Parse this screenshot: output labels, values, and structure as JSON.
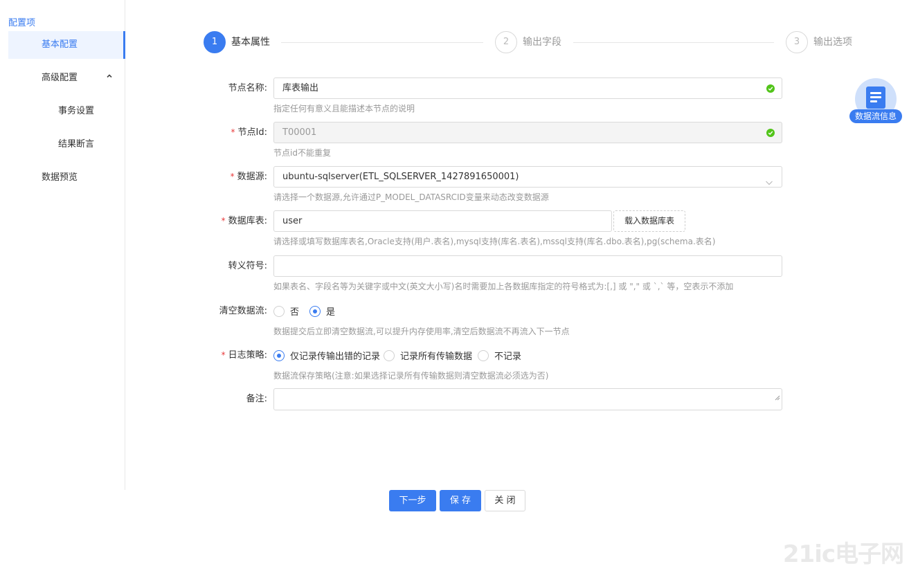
{
  "sidebar": {
    "title": "配置项",
    "items": [
      {
        "label": "基本配置"
      },
      {
        "label": "高级配置"
      },
      {
        "label": "事务设置"
      },
      {
        "label": "结果断言"
      },
      {
        "label": "数据预览"
      }
    ]
  },
  "steps": [
    {
      "num": "1",
      "label": "基本属性",
      "active": true
    },
    {
      "num": "2",
      "label": "输出字段",
      "active": false
    },
    {
      "num": "3",
      "label": "输出选项",
      "active": false
    }
  ],
  "form": {
    "node_name": {
      "label": "节点名称:",
      "value": "库表输出",
      "hint": "指定任何有意义且能描述本节点的说明"
    },
    "node_id": {
      "label": "节点Id:",
      "value": "T00001",
      "hint": "节点id不能重复"
    },
    "datasource": {
      "label": "数据源:",
      "value": "ubuntu-sqlserver(ETL_SQLSERVER_1427891650001)",
      "hint": "请选择一个数据源,允许通过P_MODEL_DATASRCID变量来动态改变数据源"
    },
    "db_table": {
      "label": "数据库表:",
      "value": "user",
      "button": "载入数据库表",
      "hint": "请选择或填写数据库表名,Oracle支持(用户.表名),mysql支持(库名.表名),mssql支持(库名.dbo.表名),pg(schema.表名)"
    },
    "escape": {
      "label": "转义符号:",
      "value": "",
      "hint": "如果表名、字段名等为关键字或中文(英文大小写)名时需要加上各数据库指定的符号格式为:[,] 或 \",\" 或 `,` 等，空表示不添加"
    },
    "clear_flow": {
      "label": "清空数据流:",
      "options": [
        "否",
        "是"
      ],
      "selected": "是",
      "hint": "数据提交后立即清空数据流,可以提升内存使用率,清空后数据流不再流入下一节点"
    },
    "log_policy": {
      "label": "日志策略:",
      "options": [
        "仅记录传输出错的记录",
        "记录所有传输数据",
        "不记录"
      ],
      "selected": "仅记录传输出错的记录",
      "hint": "数据流保存策略(注意:如果选择记录所有传输数据则清空数据流必须选为否)"
    },
    "remark": {
      "label": "备注:",
      "value": ""
    }
  },
  "dataflow_info": {
    "label": "数据流信息",
    "icon": "document-list-icon"
  },
  "footer": {
    "next": "下一步",
    "save": "保 存",
    "close": "关 闭"
  },
  "watermark": {
    "text": "21ic电子网"
  },
  "colors": {
    "accent": "#3a7cf0",
    "required": "#e8393a",
    "success": "#52c41a"
  }
}
